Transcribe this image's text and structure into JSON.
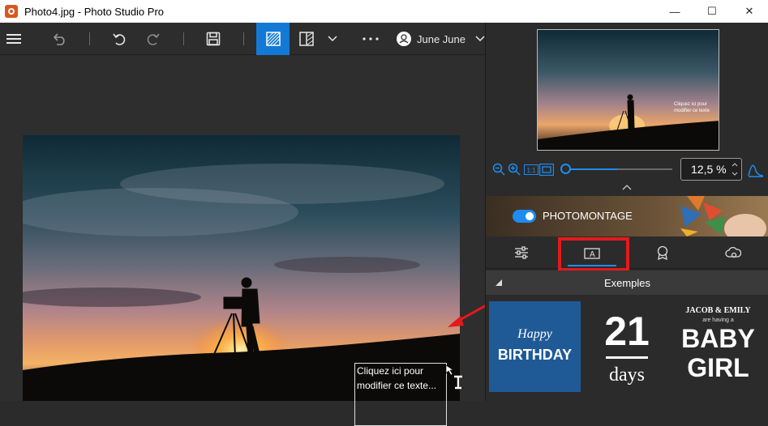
{
  "window": {
    "title": "Photo4.jpg - Photo Studio Pro",
    "minimize": "—",
    "maximize": "☐",
    "close": "✕"
  },
  "toolbar": {
    "user": "June June"
  },
  "canvas": {
    "textbox_text": "Cliquez ici pour modifier ce texte..."
  },
  "thumbnail": {
    "overlay_text": "Cliquez ici pour modifier ce texte"
  },
  "zoom": {
    "value": "12,5 %",
    "slider_level": 0
  },
  "photomontage": {
    "label": "PHOTOMONTAGE",
    "enabled": true
  },
  "section": {
    "title": "Exemples"
  },
  "examples": [
    {
      "line1": "Happy",
      "line2": "BIRTHDAY"
    },
    {
      "line1": "21",
      "line2": "days"
    },
    {
      "line1": "JACOB & EMILY",
      "line2": "are having a",
      "line3": "BABY",
      "line4": "GIRL"
    }
  ],
  "colors": {
    "accent": "#1379d6",
    "highlight": "#e5191c",
    "birthday_bg": "#1f5a96"
  }
}
